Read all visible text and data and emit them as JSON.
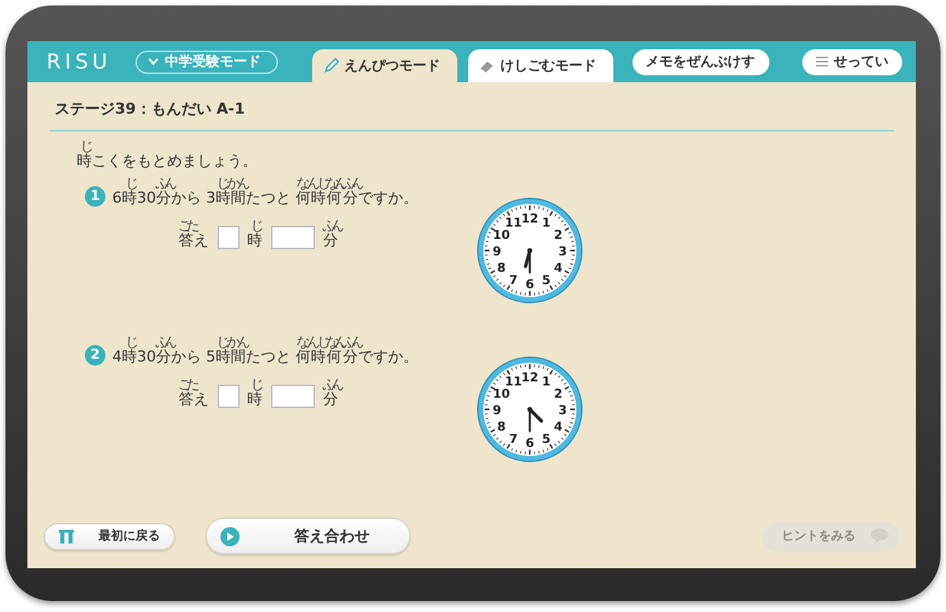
{
  "header": {
    "logo": "RISU",
    "mode_dropdown": "中学受験モード",
    "tabs": [
      {
        "label": "えんぴつモード",
        "kind": "pencil",
        "selected": true
      },
      {
        "label": "けしごむモード",
        "kind": "eraser",
        "selected": false
      }
    ],
    "clear_memo": "メモをぜんぶけす",
    "settings": "せってい"
  },
  "stage_title": "ステージ39：もんだい A-1",
  "instruction": [
    {
      "text": "時",
      "ruby": "じ"
    },
    {
      "text": "こくをもとめましょう。"
    }
  ],
  "questions": [
    {
      "number": "1",
      "text": [
        {
          "text": "6"
        },
        {
          "text": "時",
          "ruby": "じ"
        },
        {
          "text": "30"
        },
        {
          "text": "分",
          "ruby": "ふん"
        },
        {
          "text": "から "
        },
        {
          "text": "3"
        },
        {
          "text": "時間",
          "ruby": "じかん"
        },
        {
          "text": "たつと "
        },
        {
          "text": "何時",
          "ruby": "なんじ"
        },
        {
          "text": "何分",
          "ruby": "なんふん"
        },
        {
          "text": "ですか。"
        }
      ],
      "answer": [
        {
          "text": "答",
          "ruby": "こた"
        },
        {
          "text": "え"
        }
      ],
      "hour_unit": {
        "text": "時",
        "ruby": "じ"
      },
      "minute_unit": {
        "text": "分",
        "ruby": "ふん"
      },
      "clock": {
        "numbers": [
          "12",
          "11",
          "1",
          "10",
          "2",
          "9",
          "3",
          "8",
          "4",
          "7",
          "6",
          "5"
        ]
      }
    },
    {
      "number": "2",
      "text": [
        {
          "text": "4"
        },
        {
          "text": "時",
          "ruby": "じ"
        },
        {
          "text": "30"
        },
        {
          "text": "分",
          "ruby": "ふん"
        },
        {
          "text": "から "
        },
        {
          "text": "5"
        },
        {
          "text": "時間",
          "ruby": "じかん"
        },
        {
          "text": "たつと "
        },
        {
          "text": "何時",
          "ruby": "なんじ"
        },
        {
          "text": "何分",
          "ruby": "なんふん"
        },
        {
          "text": "ですか。"
        }
      ],
      "answer": [
        {
          "text": "答",
          "ruby": "こた"
        },
        {
          "text": "え"
        }
      ],
      "hour_unit": {
        "text": "時",
        "ruby": "じ"
      },
      "minute_unit": {
        "text": "分",
        "ruby": "ふん"
      },
      "clock": {
        "numbers": [
          "12",
          "11",
          "1",
          "10",
          "2",
          "9",
          "3",
          "8",
          "4",
          "7",
          "6",
          "5"
        ]
      }
    }
  ],
  "footer": {
    "back": "最初に戻る",
    "check": "答え合わせ",
    "hint": {
      "label": "ヒントをみる",
      "disabled": true
    }
  }
}
